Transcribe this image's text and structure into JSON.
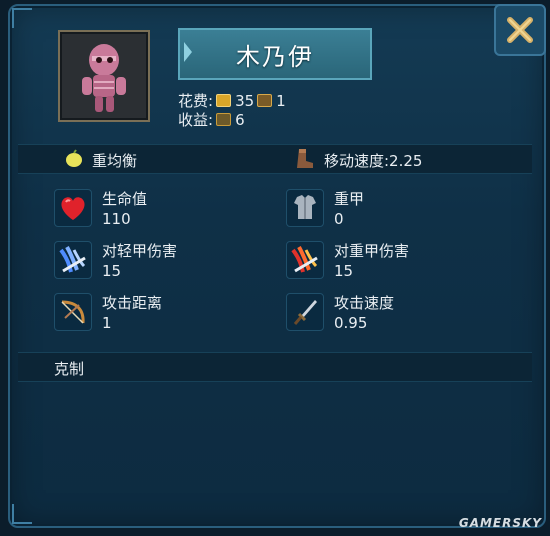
{
  "unit": {
    "name": "木乃伊",
    "cost_label": "花费:",
    "cost_gold": "35",
    "cost_pop": "1",
    "income_label": "收益:",
    "income_value": "6"
  },
  "summary": {
    "role": "重均衡",
    "move_speed": "移动速度:2.25"
  },
  "stats": {
    "hp_label": "生命值",
    "hp_value": "110",
    "armor_label": "重甲",
    "armor_value": "0",
    "light_dmg_label": "对轻甲伤害",
    "light_dmg_value": "15",
    "heavy_dmg_label": "对重甲伤害",
    "heavy_dmg_value": "15",
    "range_label": "攻击距离",
    "range_value": "1",
    "atk_speed_label": "攻击速度",
    "atk_speed_value": "0.95"
  },
  "counter": {
    "label": "克制"
  },
  "watermark": "GAMERSKY",
  "icons": {
    "close": "close-x-icon",
    "gold": "gold-coin-icon",
    "pop": "unit-population-icon",
    "income": "income-icon",
    "role": "lemon-icon",
    "move": "boot-icon",
    "hp": "heart-icon",
    "armor": "chestplate-icon",
    "light": "blue-claw-icon",
    "heavy": "red-claw-icon",
    "range": "bow-icon",
    "atk_speed": "dagger-icon"
  },
  "colors": {
    "panel": "#0f3047",
    "border": "#2a5e7d",
    "name_plate": "#2f7286",
    "close_x": "#d8b36a",
    "text": "#e9eef2"
  }
}
